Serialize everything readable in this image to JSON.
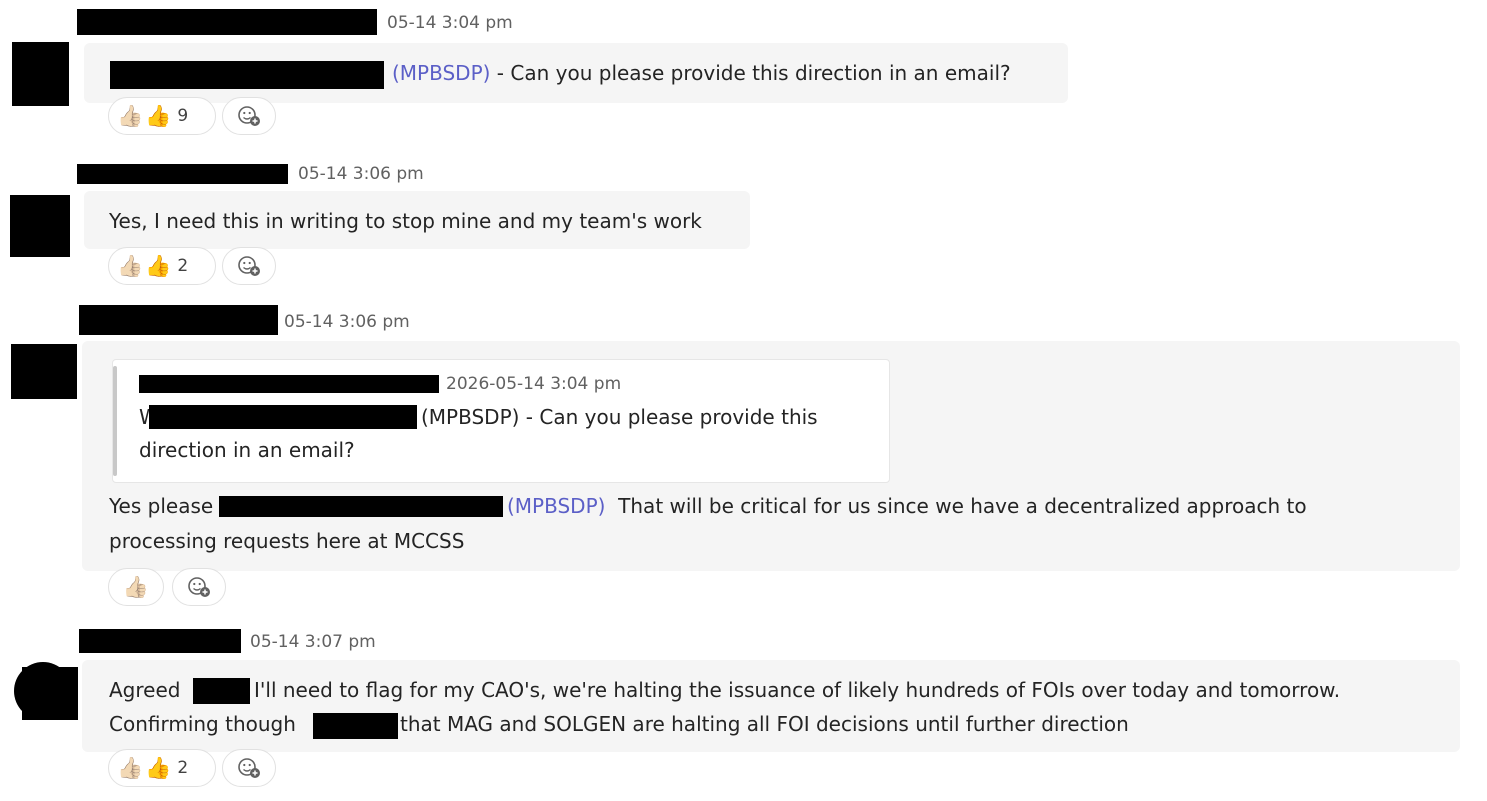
{
  "messages": [
    {
      "time": "05-14 3:04 pm",
      "text_mention": "(MPBSDP)",
      "text_rest": " - Can you please provide this direction in an email?",
      "reaction_count": "9"
    },
    {
      "time": "05-14 3:06 pm",
      "text": "Yes, I need this in writing to stop mine and my team's work",
      "reaction_count": "2"
    },
    {
      "time": "05-14 3:06 pm",
      "quote": {
        "time": "2026-05-14 3:04 pm",
        "line1_prefix": "W",
        "line1_rest": " (MPBSDP) - Can you please provide this",
        "line2": "direction in an email?"
      },
      "line1_start": "Yes please ",
      "line1_mention": "(MPBSDP)",
      "line1_rest": "  That will be critical for us since we have a decentralized approach to",
      "line2": "processing requests here at MCCSS"
    },
    {
      "time": "05-14 3:07 pm",
      "line1_start": "Agreed ",
      "line1_rest": " I'll need to flag for my CAO's, we're halting the issuance of likely hundreds of FOIs over today and tomorrow.",
      "line2_start": "Confirming though ",
      "line2_rest": " that MAG and SOLGEN are halting all FOI decisions until further direction",
      "reaction_count": "2"
    }
  ],
  "reactions": {
    "like_icon": "thumbs-up-icon",
    "add_icon": "add-reaction-icon",
    "like_glyph": "👍"
  },
  "colors": {
    "mention": "#5b5fc7",
    "bubble": "#f5f5f5",
    "timestamp": "#616161"
  }
}
